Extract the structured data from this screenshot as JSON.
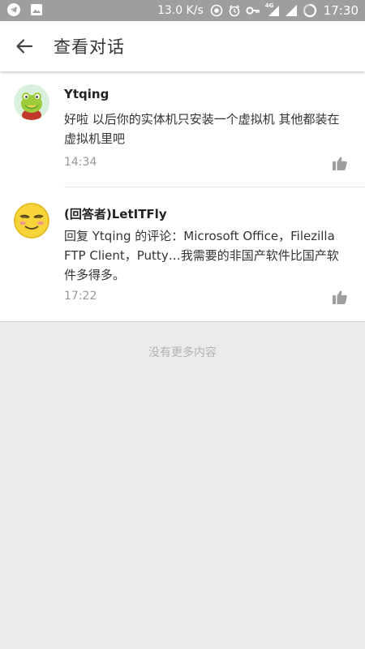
{
  "status_bar": {
    "speed": "13.0 K/s",
    "network": "4G",
    "time": "17:30"
  },
  "app_bar": {
    "title": "查看对话"
  },
  "comments": [
    {
      "author": "Ytqing",
      "text": "好啦 以后你的实体机只安装一个虚拟机 其他都装在虚拟机里吧",
      "time": "14:34"
    },
    {
      "author": "(回答者)LetITFly",
      "text": "回复 Ytqing 的评论：Microsoft Office，Filezilla FTP Client，Putty…我需要的非国产软件比国产软件多得多。",
      "time": "17:22"
    }
  ],
  "footer": {
    "no_more": "没有更多内容"
  },
  "colors": {
    "status_bar_bg": "#9e9e9e",
    "page_bg": "#ebebeb",
    "card_bg": "#ffffff",
    "muted_text": "#999999"
  },
  "icons": {
    "status_left": [
      "telegram-icon",
      "image-icon"
    ],
    "status_right": [
      "circle-dot-icon",
      "alarm-icon",
      "key-icon",
      "signal-4g-icon",
      "signal-icon",
      "battery-icon"
    ],
    "back": "arrow-left-icon",
    "like": "thumbs-up-icon"
  }
}
